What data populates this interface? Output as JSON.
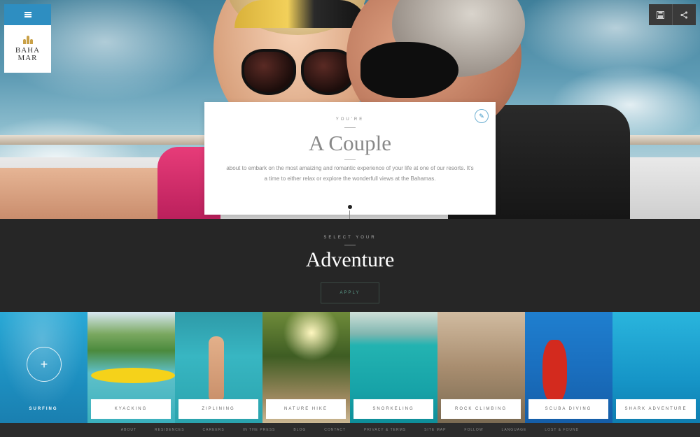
{
  "brand": {
    "logo_line1": "BAHA",
    "logo_line2": "MAR"
  },
  "tools": {
    "save_icon": "save-icon",
    "share_icon": "share-icon"
  },
  "card": {
    "kicker": "YOU'RE",
    "title": "A Couple",
    "body": "about to embark on the most amaizing and romantic experience of your life at one of our resorts. It's a time to either relax or explore the wonderfull views at the Bahamas."
  },
  "adventure": {
    "kicker": "SELECT YOUR",
    "title": "Adventure",
    "apply_label": "APPLY"
  },
  "tiles": [
    {
      "label": "SURFING"
    },
    {
      "label": "KYACKING"
    },
    {
      "label": "ZIPLINING"
    },
    {
      "label": "NATURE HIKE"
    },
    {
      "label": "SNORKELING"
    },
    {
      "label": "ROCK CLIMBING"
    },
    {
      "label": "SCUBA DIVING"
    },
    {
      "label": "SHARK ADVENTURE"
    }
  ],
  "footer": {
    "links": [
      "ABOUT",
      "RESIDENCES",
      "CAREERS",
      "IN THE PRESS",
      "BLOG",
      "CONTACT",
      "PRIVACY & TERMS",
      "SITE MAP",
      "FOLLOW",
      "LANGUAGE",
      "LOST & FOUND"
    ]
  },
  "colors": {
    "accent": "#2e8ec1",
    "dark": "#262626",
    "gold": "#c9a148"
  }
}
